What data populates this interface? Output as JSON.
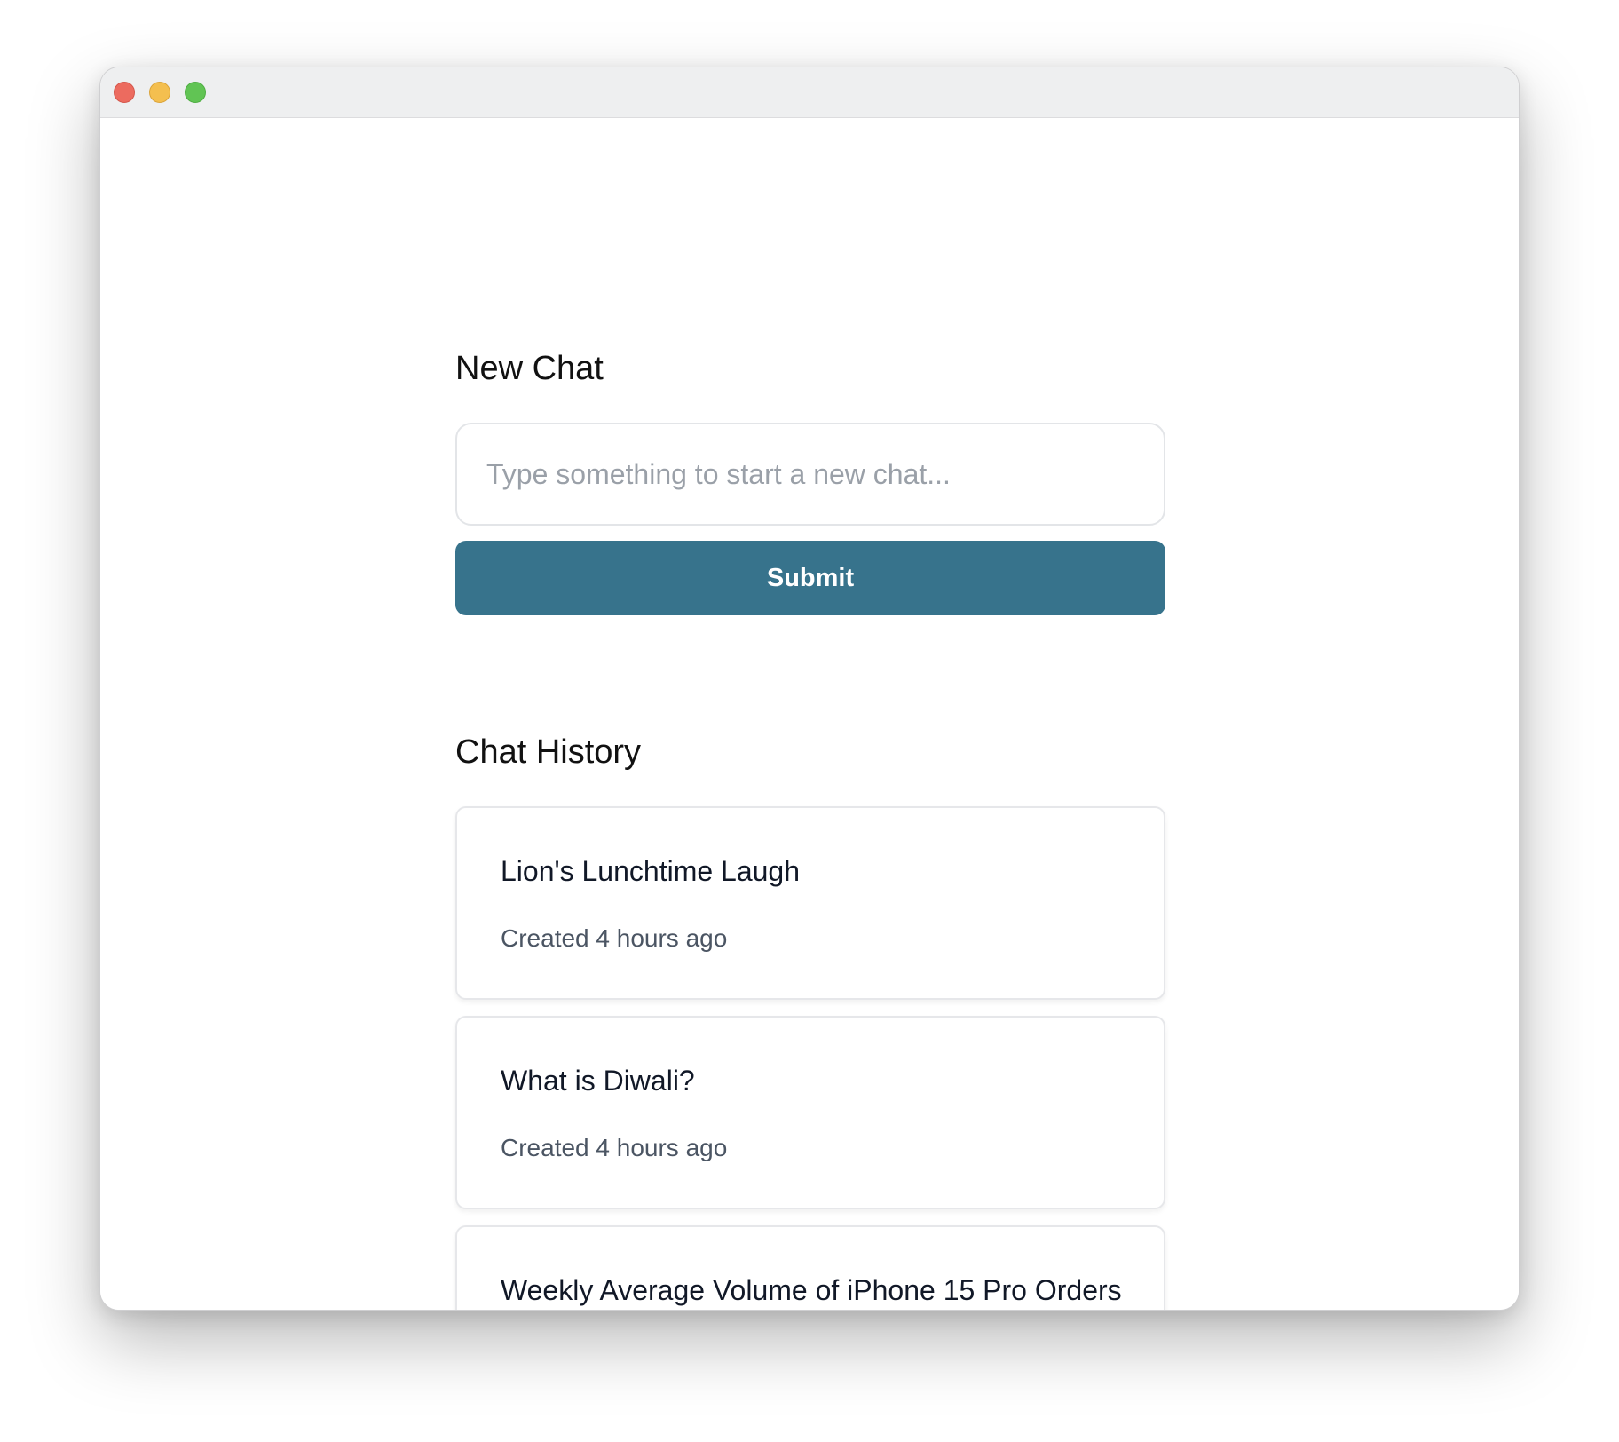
{
  "window": {
    "controls": [
      "close-icon",
      "minimize-icon",
      "maximize-icon"
    ]
  },
  "new_chat": {
    "heading": "New Chat",
    "input_value": "",
    "input_placeholder": "Type something to start a new chat...",
    "submit_label": "Submit"
  },
  "history": {
    "heading": "Chat History",
    "items": [
      {
        "title": "Lion's Lunchtime Laugh",
        "meta": "Created 4 hours ago"
      },
      {
        "title": "What is Diwali?",
        "meta": "Created 4 hours ago"
      },
      {
        "title": "Weekly Average Volume of iPhone 15 Pro Orders",
        "meta": ""
      }
    ]
  },
  "colors": {
    "accent": "#37738c",
    "close": "#ec6b5f",
    "minimize": "#f4bf4f",
    "maximize": "#61c454"
  }
}
